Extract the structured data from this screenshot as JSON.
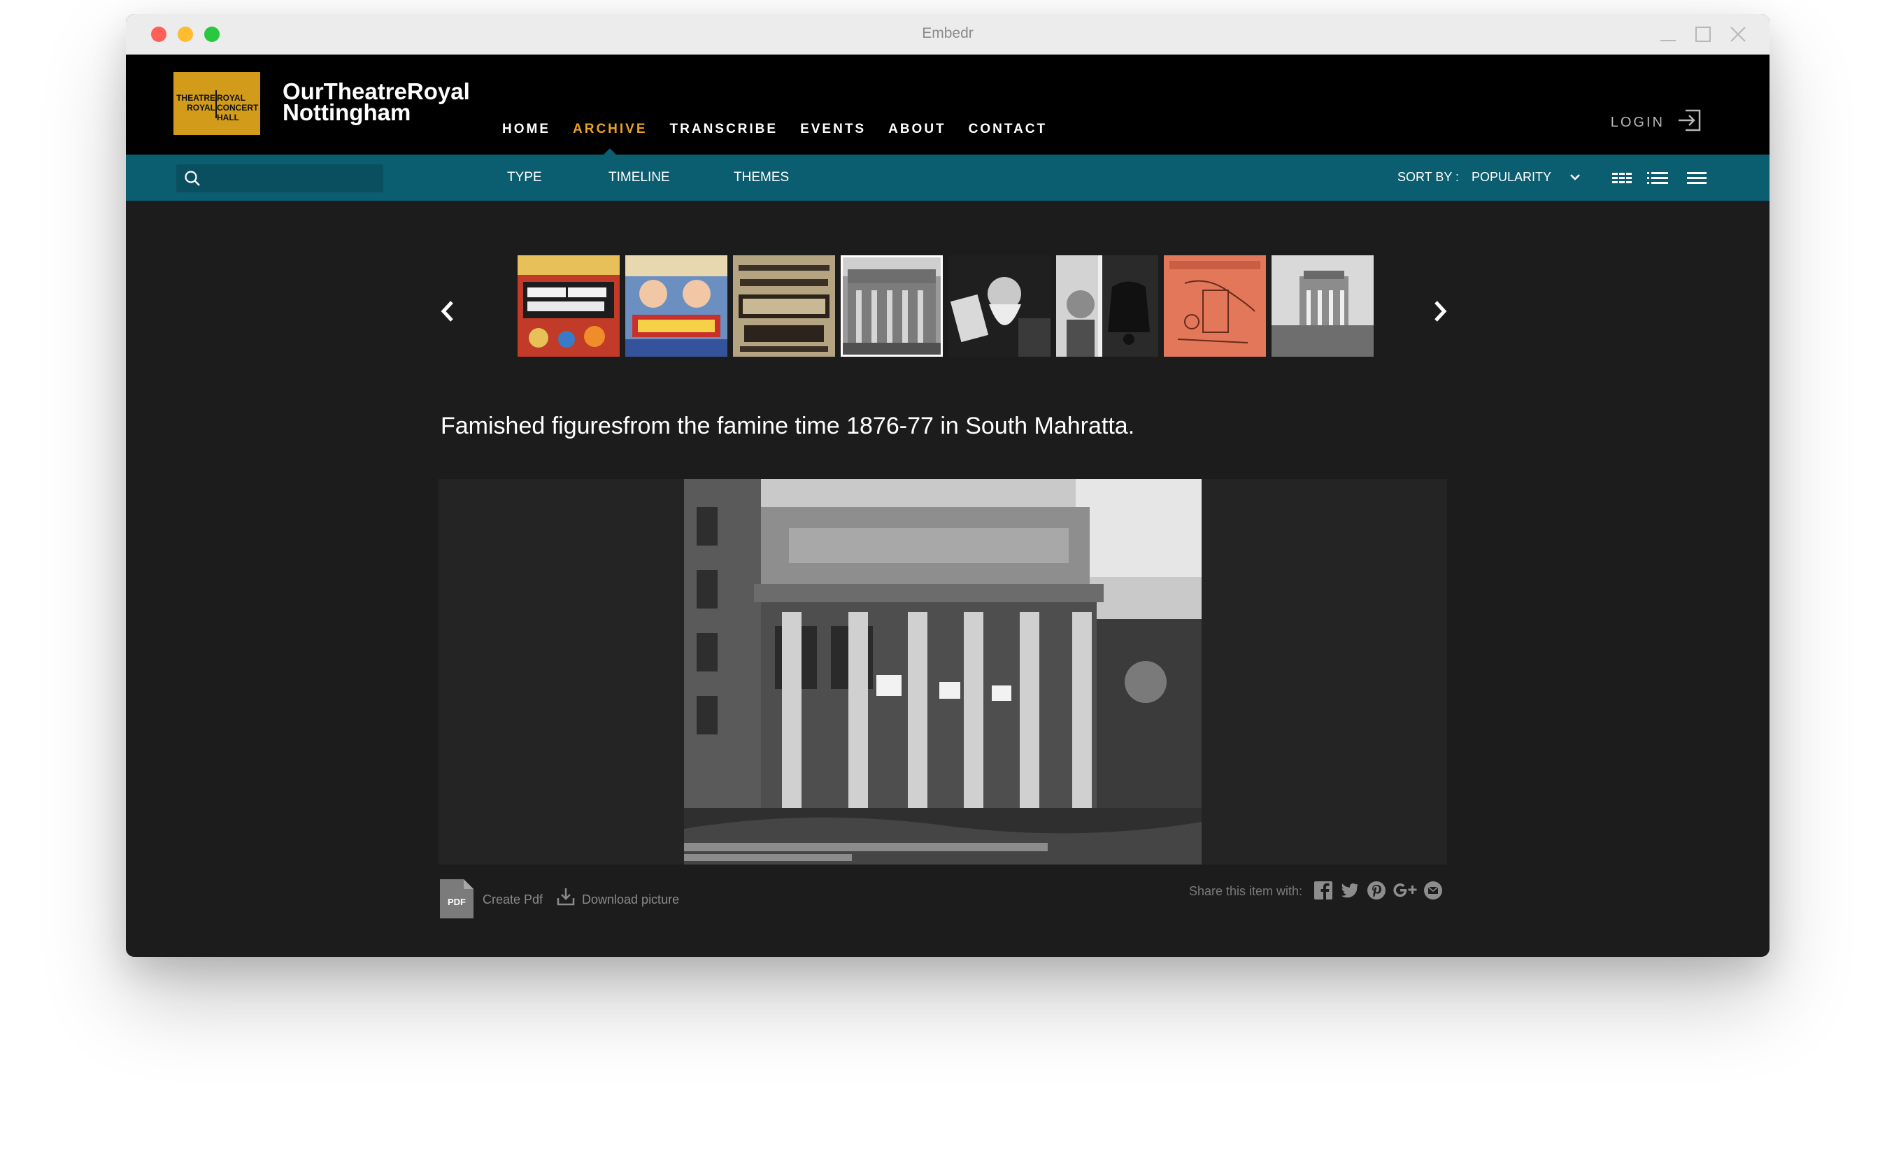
{
  "window": {
    "title": "Embedr"
  },
  "brand": {
    "logo_left": "THEATRE\nROYAL",
    "logo_right": "ROYAL\nCONCERT\nHALL",
    "name_line1": "OurTheatreRoyal",
    "name_line2": "Nottingham",
    "accent_color": "#e8a327",
    "bar_color": "#0b5d70"
  },
  "nav": {
    "items": [
      {
        "label": "HOME",
        "active": false
      },
      {
        "label": "ARCHIVE",
        "active": true
      },
      {
        "label": "TRANSCRIBE",
        "active": false
      },
      {
        "label": "EVENTS",
        "active": false
      },
      {
        "label": "ABOUT",
        "active": false
      },
      {
        "label": "CONTACT",
        "active": false
      }
    ],
    "login_label": "LOGIN"
  },
  "subnav": {
    "search_placeholder": "",
    "filters": [
      "TYPE",
      "TIMELINE",
      "THEMES"
    ],
    "sort_label": "SORT BY :",
    "sort_value": "POPULARITY"
  },
  "carousel": {
    "selected_index": 3,
    "thumbnails": [
      "black-and-white-minstrel-show-poster",
      "dick-whittington-poster",
      "house-that-jack-built-poster",
      "theatre-royal-facade-photo",
      "bearded-man-reading-photo",
      "woman-with-bell-photo",
      "sketch-map",
      "theatre-royal-street-photo"
    ]
  },
  "item": {
    "title": "Famished figuresfrom the famine time 1876-77 in South Mahratta.",
    "image_subject": "theatre-royal-facade-photo"
  },
  "actions": {
    "pdf_badge": "PDF",
    "create_pdf": "Create Pdf",
    "download": "Download picture",
    "share_label": "Share this item with:",
    "share_icons": [
      "facebook-icon",
      "twitter-icon",
      "pinterest-icon",
      "google-plus-icon",
      "email-icon"
    ]
  }
}
